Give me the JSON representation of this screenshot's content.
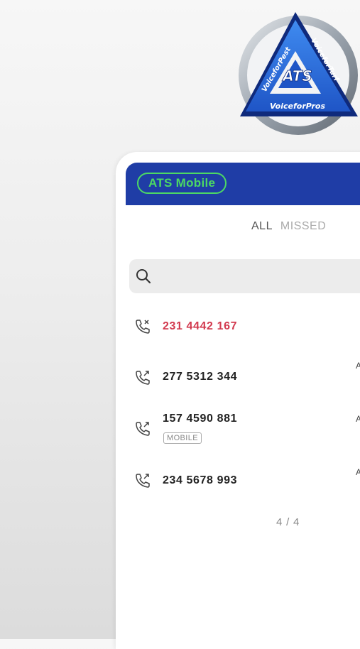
{
  "logo": {
    "center_text": "ATS",
    "left_text": "VoiceforPest",
    "right_text": "VoiceforTurf",
    "bottom_text": "VoiceforPros",
    "colors": {
      "blue": "#2f6fd6",
      "dark_blue": "#12318c",
      "ring": "#9aa3ad"
    }
  },
  "app": {
    "badge_label": "ATS Mobile",
    "accent_color": "#1f3da6",
    "badge_color": "#4cd964"
  },
  "tabs": [
    {
      "label": "ALL",
      "active": true
    },
    {
      "label": "MISSED",
      "active": false
    }
  ],
  "search": {
    "placeholder": "",
    "icon": "search-icon"
  },
  "calls": [
    {
      "number": "231 4442 167",
      "type": "missed",
      "icon": "call-missed-icon",
      "tag": "",
      "side": ""
    },
    {
      "number": "277 5312 344",
      "type": "outgoing",
      "icon": "call-outgoing-icon",
      "tag": "",
      "side": "A"
    },
    {
      "number": "157 4590 881",
      "type": "outgoing",
      "icon": "call-outgoing-icon",
      "tag": "MOBILE",
      "side": "A"
    },
    {
      "number": "234 5678 993",
      "type": "outgoing",
      "icon": "call-outgoing-icon",
      "tag": "",
      "side": "A"
    }
  ],
  "pagination": "4 / 4"
}
